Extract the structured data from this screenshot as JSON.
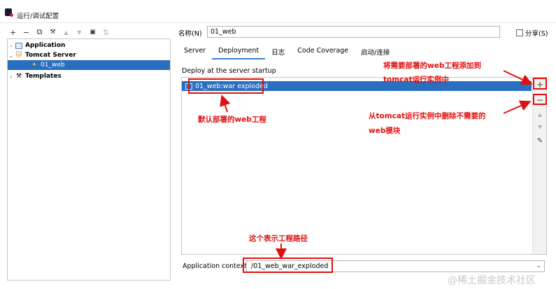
{
  "window": {
    "title": "运行/调试配置"
  },
  "toolbar": {
    "items": [
      {
        "icon": "add-icon",
        "glyph": "+"
      },
      {
        "icon": "remove-icon",
        "glyph": "−"
      },
      {
        "icon": "copy-icon",
        "glyph": "⧉"
      },
      {
        "icon": "wrench-icon",
        "glyph": "🔧"
      },
      {
        "icon": "move-up-icon",
        "glyph": "▲"
      },
      {
        "icon": "move-down-icon",
        "glyph": "▼"
      },
      {
        "icon": "folder-icon",
        "glyph": "▣"
      },
      {
        "icon": "sort-icon",
        "glyph": "⇅"
      }
    ]
  },
  "tree": {
    "application": "Application",
    "tomcat": "Tomcat Server",
    "config": "01_web",
    "templates": "Templates"
  },
  "form": {
    "name_label": "名称(N)",
    "name_value": "01_web",
    "share_label": "分享(S)"
  },
  "tabs": [
    "Server",
    "Deployment",
    "日志",
    "Code Coverage",
    "启动/连接"
  ],
  "active_tab": "Deployment",
  "deploy": {
    "section_label": "Deploy at the server startup",
    "item": "01_web:war exploded"
  },
  "context": {
    "label": "Application context:",
    "value": "/01_web_war_exploded"
  },
  "annotations": {
    "add_line1": "将需要部署的web工程添加到",
    "add_line2": "tomcat运行实例中",
    "default_project": "默认部署的web工程",
    "remove_line1": "从tomcat运行实例中删除不需要的",
    "remove_line2": "web模块",
    "path": "这个表示工程路径"
  },
  "watermark": "@稀土掘金技术社区",
  "colors": {
    "selection": "#2a6ebf",
    "annotation": "#e01010",
    "tab_underline": "#3b7fd6"
  }
}
